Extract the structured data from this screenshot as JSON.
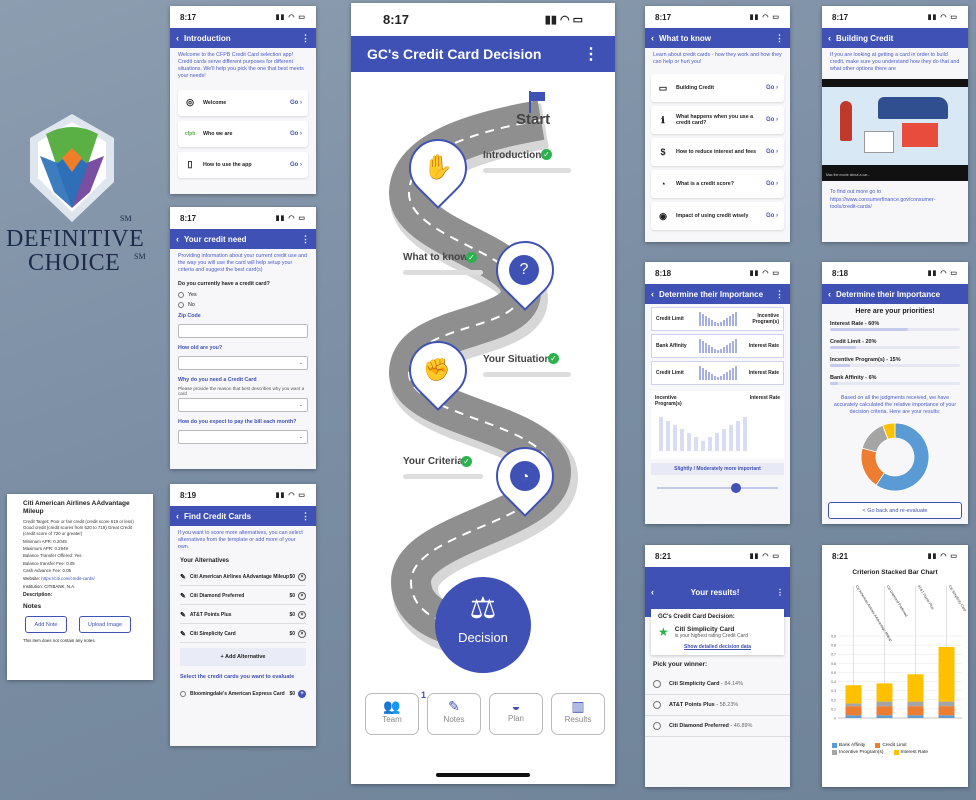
{
  "logo": {
    "line1": "DEFINITIVE",
    "line2": "CHOICE",
    "sm": "SM"
  },
  "colors": {
    "primary": "#3f51b5",
    "check": "#2bb24c",
    "road": "#8f8f8f",
    "bg": "#7f91a6"
  },
  "intro": {
    "time": "8:17",
    "title": "Introduction",
    "desc": "Welcome to the CFPB Credit Card selection app! Credit cards serve different purposes for different situations. We'll help you pick the one that best meets your needs!",
    "items": [
      {
        "label": "Welcome",
        "icon": "fingerprint-icon"
      },
      {
        "label": "Who we are",
        "icon": "cfpb-icon"
      },
      {
        "label": "How to use the app",
        "icon": "phone-icon"
      }
    ],
    "go": "Go"
  },
  "need": {
    "time": "8:17",
    "title": "Your credit need",
    "desc": "Providing information about your current credit use and the way you will use the card will help setup your criteria and suggest the best card(s)",
    "q1": "Do you currently have a credit card?",
    "yes": "Yes",
    "no": "No",
    "zip": "Zip Code",
    "age": "How old are you?",
    "why": "Why do you need a Credit Card",
    "why_hint": "Please provide the reason that best describes why you want a card",
    "pay": "How do you expect to pay the bill each month?"
  },
  "detail": {
    "title": "Citi American Airlines AAdvantage Mileup",
    "lines": [
      "Credit Target:  Poor or fair credit (credit score 619 or less) Good credit (credit scores from 620 to 719) Great Credit (credit score of 720 or greater)",
      "Minimum APR:  0.2049",
      "Maximum APR:  0.2949",
      "Balance Transfer Offered:  Yes",
      "Balance transfer Fee:  0.05",
      "Cash Advance Fee:  0.05"
    ],
    "website_label": "Website:",
    "website": "https://citi.com/credit-cards/",
    "institution": "Institution:  CITIBANK, N.A.",
    "description": "Description:",
    "notes": "Notes",
    "add_note": "Add Note",
    "upload": "Upload Image",
    "empty": "This item does not contain any notes."
  },
  "find": {
    "time": "8:19",
    "title": "Find Credit Cards",
    "desc": "If you want to score more alternatives, you can select alternatives from the template or add more of your own.",
    "section": "Your Alternatives",
    "alts": [
      "Citi American Airlines AAdvantage Mileup",
      "Citi Diamond Preferred",
      "AT&T Points Plus",
      "Citi Simplicity Card"
    ],
    "score": "$0",
    "add": "+ Add Alternative",
    "select": "Select the credit cards you want to evaluate",
    "extra": "Bloomingdale's American Express Card"
  },
  "main": {
    "time": "8:17",
    "title": "GC's Credit Card Decision",
    "start": "Start",
    "steps": [
      "Introduction",
      "What to know",
      "Your Situation",
      "Your Criteria"
    ],
    "decision": "Decision",
    "tabs": [
      "Team",
      "Notes",
      "Plan",
      "Results"
    ],
    "team_badge": "1"
  },
  "know": {
    "time": "8:17",
    "title": "What to know",
    "desc": "Learn about credit cards - how they work and how they can help or hurt you!",
    "items": [
      {
        "label": "Building Credit",
        "icon": "card-icon"
      },
      {
        "label": "What happens when you use a credit card?",
        "icon": "info-icon"
      },
      {
        "label": "How to reduce interest and fees",
        "icon": "coin-icon"
      },
      {
        "label": "What is a credit score?",
        "icon": "gauge-icon"
      },
      {
        "label": "Impact of using credit wisely",
        "icon": "glasses-icon"
      }
    ],
    "go": "Go"
  },
  "building": {
    "time": "8:17",
    "title": "Building Credit",
    "desc": "If you are looking at getting a card in order to build credit, make sure you understand how they do that and what other options there are",
    "video_caption": "Max the movie about a car...",
    "find_more": "To find out more go to https://www.consumerfinance.gov/consumer-tools/credit-cards/"
  },
  "importance": {
    "time": "8:18",
    "title": "Determine their Importance",
    "pairs": [
      [
        "Credit Limit",
        "Incentive Program(s)"
      ],
      [
        "Bank Affinity",
        "Interest Rate"
      ],
      [
        "Credit Limit",
        "Interest Rate"
      ]
    ],
    "big_left": "Incentive Program(s)",
    "big_right": "Interest Rate",
    "verdict": "Slightly / Moderately more important"
  },
  "priorities": {
    "time": "8:18",
    "title": "Determine their Importance",
    "heading": "Here are your priorities!",
    "items": [
      {
        "label": "Interest Rate",
        "pct": "60%",
        "value": 60
      },
      {
        "label": "Credit Limit",
        "pct": "20%",
        "value": 20
      },
      {
        "label": "Incentive Program(s)",
        "pct": "15%",
        "value": 15
      },
      {
        "label": "Bank Affinity",
        "pct": "6%",
        "value": 6
      }
    ],
    "note": "Based on all the judgments received, we have accurately calculated the relative importance of your decision criteria. Here are your results:",
    "back": "< Go back and re-evaluate"
  },
  "results": {
    "time": "8:21",
    "title": "Your results!",
    "decision": "GC's Credit Card Decision:",
    "winner": "Citi Simplicity Card",
    "winner_sub": "is your highest rating Credit Card",
    "detail_link": "Show detailed decision data",
    "pick": "Pick your winner:",
    "list": [
      {
        "name": "Citi Simplicity Card",
        "score": "84.14%"
      },
      {
        "name": "AT&T Points Plus",
        "score": "58.23%"
      },
      {
        "name": "Citi Diamond Preferred",
        "score": "46.89%"
      }
    ]
  },
  "chart_data": [
    {
      "type": "pie",
      "title": "",
      "categories": [
        "Interest Rate",
        "Credit Limit",
        "Incentive Program(s)",
        "Bank Affinity"
      ],
      "values": [
        60,
        20,
        15,
        6
      ],
      "colors": [
        "#5b9bd5",
        "#ed7d31",
        "#a5a5a5",
        "#ffc000"
      ]
    },
    {
      "type": "bar",
      "title": "Criterion Stacked Bar Chart",
      "categories": [
        "Citi American Airlines AAdvantage Mileup",
        "Citi Diamond Preferred",
        "AT&T Points Plus",
        "Citi Simplicity Card"
      ],
      "series": [
        {
          "name": "Bank Affinity",
          "values": [
            0.03,
            0.03,
            0.03,
            0.03
          ],
          "color": "#5b9bd5"
        },
        {
          "name": "Credit Limit",
          "values": [
            0.1,
            0.1,
            0.1,
            0.1
          ],
          "color": "#ed7d31"
        },
        {
          "name": "Incentive Program(s)",
          "values": [
            0.03,
            0.05,
            0.05,
            0.05
          ],
          "color": "#a5a5a5"
        },
        {
          "name": "Interest Rate",
          "values": [
            0.2,
            0.2,
            0.3,
            0.6
          ],
          "color": "#ffc000"
        }
      ],
      "yticks": [
        "0.9",
        "0.8",
        "0.7",
        "0.6",
        "0.5",
        "0.4",
        "0.3",
        "0.2",
        "0.1",
        "0"
      ],
      "ylim": [
        0,
        0.9
      ]
    }
  ]
}
